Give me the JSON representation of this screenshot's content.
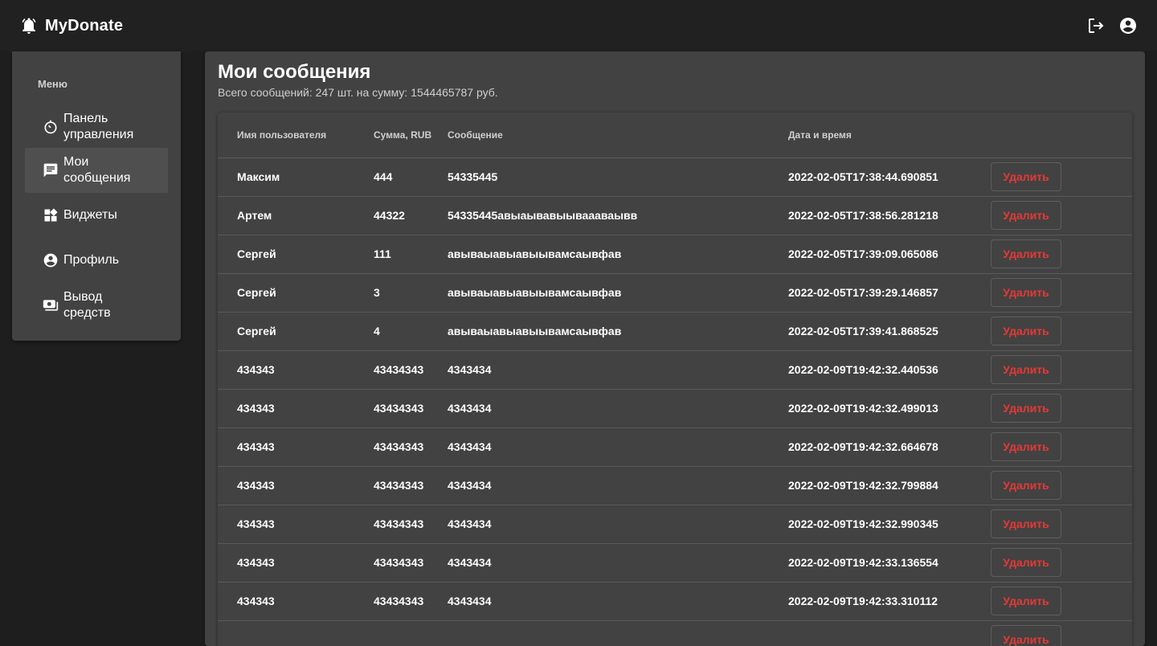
{
  "app": {
    "name": "MyDonate"
  },
  "header": {
    "icons": [
      "logout-icon",
      "account-circle-icon"
    ]
  },
  "sidebar": {
    "title": "Меню",
    "items": [
      {
        "label": "Панель\nуправления",
        "icon": "dashboard-timer-icon",
        "active": false
      },
      {
        "label": "Мои\nсообщения",
        "icon": "message-icon",
        "active": true
      },
      {
        "label": "Виджеты",
        "icon": "widgets-icon",
        "active": false
      },
      {
        "label": "Профиль",
        "icon": "account-circle-icon",
        "active": false
      },
      {
        "label": "Вывод\nсредств",
        "icon": "payments-icon",
        "active": false
      }
    ]
  },
  "main": {
    "title": "Мои сообщения",
    "subtitle": "Всего сообщений: 247 шт. на сумму: 1544465787 руб.",
    "table": {
      "headers": {
        "user": "Имя пользователя",
        "sum": "Сумма, RUB",
        "message": "Сообщение",
        "date": "Дата и время"
      },
      "delete_label": "Удалить",
      "rows": [
        {
          "user": "Максим",
          "sum": "444",
          "message": "54335445",
          "date": "2022-02-05T17:38:44.690851"
        },
        {
          "user": "Артем",
          "sum": "44322",
          "message": "54335445авыаывавыываааваывв",
          "date": "2022-02-05T17:38:56.281218"
        },
        {
          "user": "Сергей",
          "sum": "111",
          "message": "авываыавыавыывамсаывфав",
          "date": "2022-02-05T17:39:09.065086"
        },
        {
          "user": "Сергей",
          "sum": "3",
          "message": "авываыавыавыывамсаывфав",
          "date": "2022-02-05T17:39:29.146857"
        },
        {
          "user": "Сергей",
          "sum": "4",
          "message": "авываыавыавыывамсаывфав",
          "date": "2022-02-05T17:39:41.868525"
        },
        {
          "user": "434343",
          "sum": "43434343",
          "message": "4343434",
          "date": "2022-02-09T19:42:32.440536"
        },
        {
          "user": "434343",
          "sum": "43434343",
          "message": "4343434",
          "date": "2022-02-09T19:42:32.499013"
        },
        {
          "user": "434343",
          "sum": "43434343",
          "message": "4343434",
          "date": "2022-02-09T19:42:32.664678"
        },
        {
          "user": "434343",
          "sum": "43434343",
          "message": "4343434",
          "date": "2022-02-09T19:42:32.799884"
        },
        {
          "user": "434343",
          "sum": "43434343",
          "message": "4343434",
          "date": "2022-02-09T19:42:32.990345"
        },
        {
          "user": "434343",
          "sum": "43434343",
          "message": "4343434",
          "date": "2022-02-09T19:42:33.136554"
        },
        {
          "user": "434343",
          "sum": "43434343",
          "message": "4343434",
          "date": "2022-02-09T19:42:33.310112"
        },
        {
          "user": "",
          "sum": "",
          "message": "",
          "date": ""
        }
      ]
    }
  },
  "colors": {
    "delete": "#e53935",
    "background": "#1e1e1e",
    "surface": "#424242",
    "appbar": "#212121"
  }
}
